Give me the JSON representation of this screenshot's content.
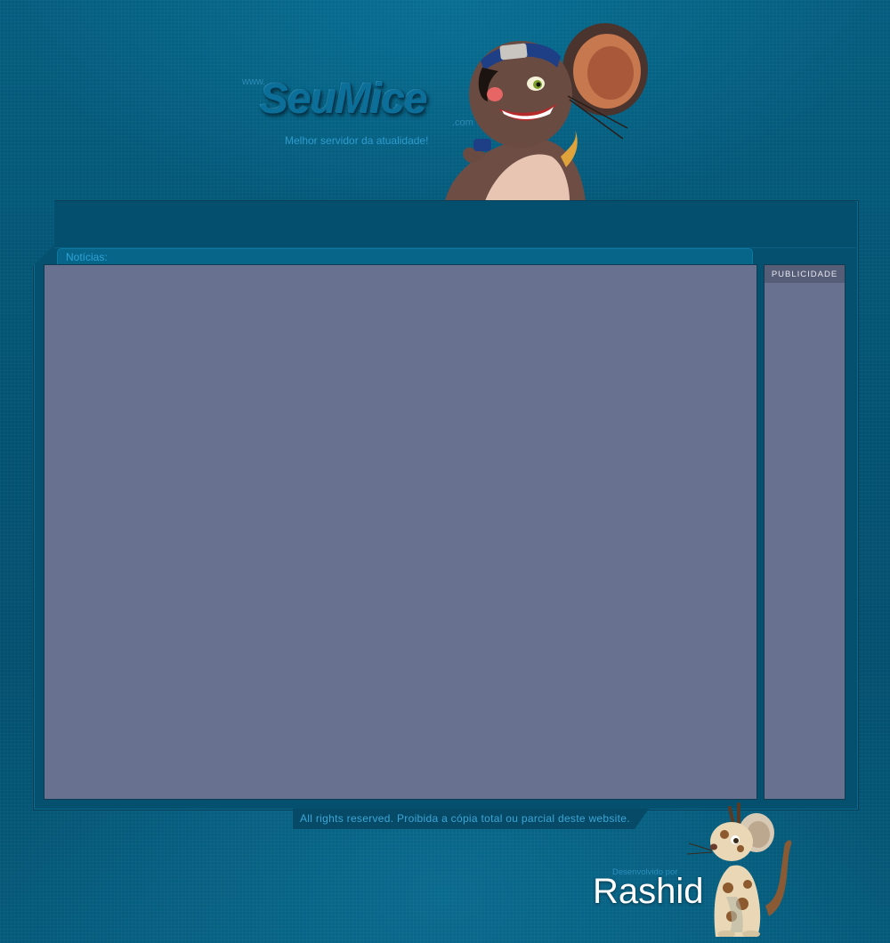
{
  "header": {
    "logo_prefix": "www.",
    "logo_name": "SeuMice",
    "logo_suffix": ".com",
    "tagline": "Melhor servidor da atualidade!"
  },
  "main": {
    "news_label": "Notícias:"
  },
  "sidebar": {
    "ad_label": "PUBLICIDADE"
  },
  "footer": {
    "copyright": "All rights reserved. Proibida a cópia total ou parcial deste website.",
    "developer_prefix": "Desenvolvido por",
    "developer_name": "Rashid"
  },
  "icons": {
    "mascot": "mouse-mascot-icon",
    "developer_mascot": "giraffe-mouse-icon"
  },
  "colors": {
    "background": "#05567a",
    "panel": "#687290",
    "accent_text": "#2ea3d4"
  }
}
